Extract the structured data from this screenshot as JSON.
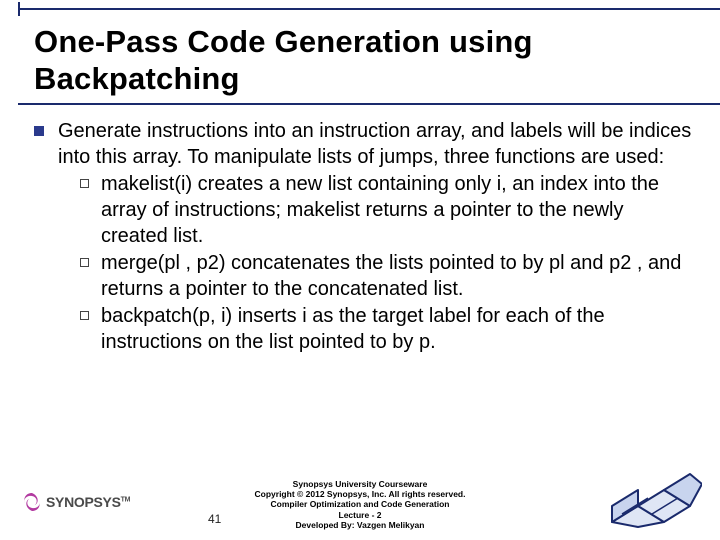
{
  "title": "One-Pass Code Generation using Backpatching",
  "body": {
    "intro": "Generate instructions into an instruction array, and labels will be indices into this array. To manipulate lists of jumps, three functions are used:",
    "items": [
      "makelist(i) creates a new list containing only i, an index into the array of instructions; makelist returns a pointer to the newly created list.",
      "merge(pl , p2) concatenates the lists pointed to by pl and p2 , and returns a pointer to the concatenated list.",
      "backpatch(p, i) inserts i as the target label for each of the instructions on the list pointed to by p."
    ]
  },
  "footer": {
    "page": "41",
    "credits": [
      "Synopsys University Courseware",
      "Copyright © 2012 Synopsys, Inc. All rights reserved.",
      "Compiler Optimization and Code Generation",
      "Lecture - 2",
      "Developed By: Vazgen Melikyan"
    ],
    "brand": "SYNOPSYS",
    "tm": "TM"
  }
}
